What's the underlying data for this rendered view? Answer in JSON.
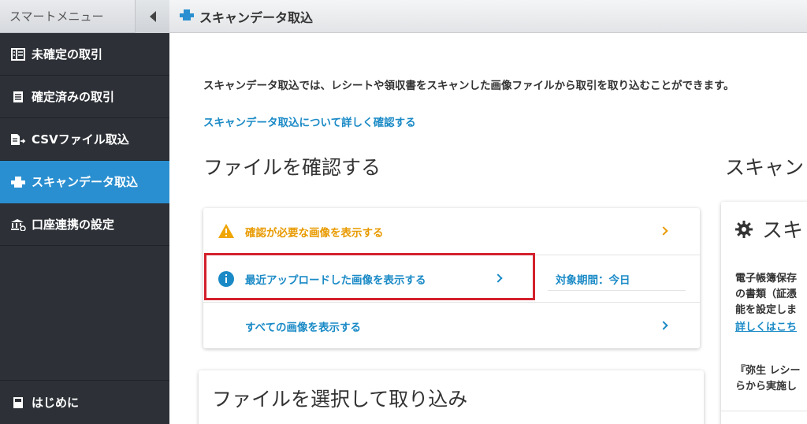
{
  "sidebar": {
    "title": "スマートメニュー",
    "items": [
      {
        "label": "未確定の取引",
        "icon": "list-icon"
      },
      {
        "label": "確定済みの取引",
        "icon": "document-icon"
      },
      {
        "label": "CSVファイル取込",
        "icon": "csv-import-icon"
      },
      {
        "label": "スキャンデータ取込",
        "icon": "scanner-icon"
      },
      {
        "label": "口座連携の設定",
        "icon": "bank-sync-icon"
      }
    ],
    "bottom_label": "はじめに"
  },
  "topbar": {
    "title": "スキャンデータ取込"
  },
  "main": {
    "description": "スキャンデータ取込では、レシートや領収書をスキャンした画像ファイルから取引を取り込むことができます。",
    "detail_link": "スキャンデータ取込について詳しく確認する",
    "confirm_section_title": "ファイルを確認する",
    "rows": [
      {
        "label": "確認が必要な画像を表示する",
        "icon": "warning-icon"
      },
      {
        "label": "最近アップロードした画像を表示する",
        "icon": "info-icon",
        "period": "対象期間：今日"
      },
      {
        "label": "すべての画像を表示する",
        "icon": ""
      }
    ],
    "select_section_title": "ファイルを選択して取り込み",
    "right_section_title": "スキャン",
    "right_card": {
      "title": "スキ",
      "lines": [
        "電子帳簿保存",
        "の書類（証憑",
        "能を設定しま"
      ],
      "link": "詳しくはこち",
      "note_lines": [
        "『弥生 レシー",
        "らから実施し"
      ]
    }
  },
  "colors": {
    "accent": "#2a8fd0",
    "link": "#1a8ac6",
    "warning": "#f0a500",
    "highlight": "#d3212d"
  }
}
